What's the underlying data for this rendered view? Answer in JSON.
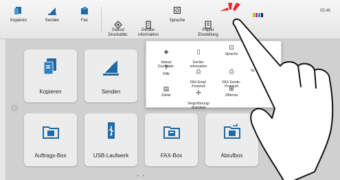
{
  "toolbar": {
    "items": [
      {
        "label": "Kopieren",
        "icon": "copy-icon"
      },
      {
        "label": "Senden",
        "icon": "send-icon"
      },
      {
        "label": "Fax",
        "icon": "fax-icon"
      },
      {
        "label": "Status/\nDruckabbr.",
        "icon": "status-icon"
      },
      {
        "label": "Geräte-\ninformation",
        "icon": "device-info-icon"
      },
      {
        "label": "Sprache",
        "icon": "language-icon"
      },
      {
        "label": "Papier\nEinstellung",
        "icon": "paper-icon"
      }
    ],
    "clock": "05:46"
  },
  "home": {
    "tiles": [
      {
        "label": "Kopieren",
        "icon": "copy-icon"
      },
      {
        "label": "Senden",
        "icon": "send-icon"
      },
      {
        "label": "Auftrags-Box",
        "icon": "job-box-icon"
      },
      {
        "label": "USB-Laufwerk",
        "icon": "usb-icon"
      },
      {
        "label": "FAX-Box",
        "icon": "fax-box-icon"
      },
      {
        "label": "Abrufbox",
        "icon": "polling-box-icon"
      }
    ]
  },
  "popup": {
    "items": [
      {
        "label": "Status/\nDruckabbr.",
        "icon": "status-icon"
      },
      {
        "label": "Geräte-\ninformation",
        "icon": "device-info-icon"
      },
      {
        "label": "Sprache",
        "icon": "language-icon"
      },
      {
        "label": "Hilfe",
        "icon": "help-icon"
      },
      {
        "label": "FAX-Empf.\nProtokoll",
        "icon": "fax-receive-log-icon"
      },
      {
        "label": "FAX-Sende-\nProtokoll",
        "icon": "fax-send-log-icon"
      },
      {
        "label": "Sy",
        "icon": "system-icon"
      },
      {
        "label": "Zähler",
        "icon": "counter-icon"
      },
      {
        "label": "Vergrößerung/\nStandard",
        "icon": "magnify-icon"
      },
      {
        "label": "Ziffernta",
        "icon": "keypad-icon"
      }
    ]
  },
  "colors": {
    "accent": "#1e6aa6",
    "highlight": "#e8292f"
  }
}
